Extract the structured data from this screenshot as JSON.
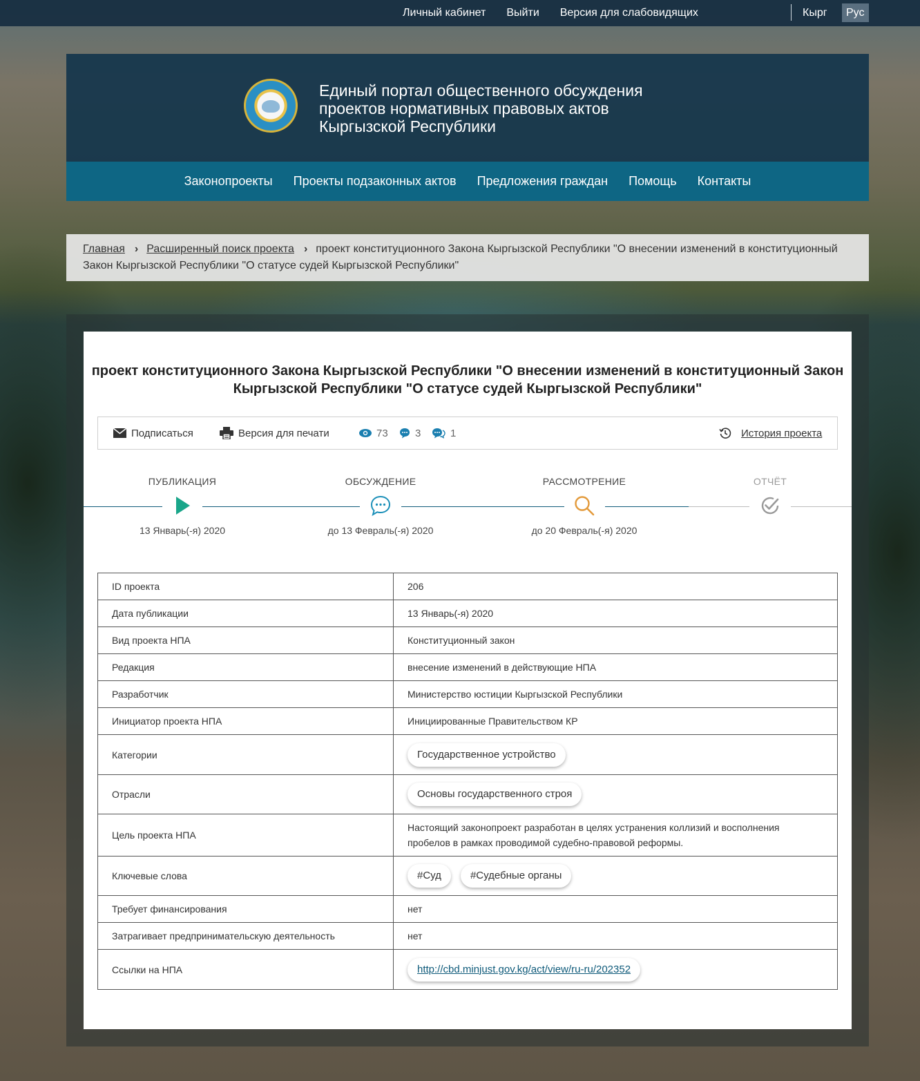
{
  "topbar": {
    "cabinet": "Личный кабинет",
    "logout": "Выйти",
    "low_vision": "Версия для слабовидящих",
    "lang_kg": "Кырг",
    "lang_ru": "Рус"
  },
  "header": {
    "title_lines": [
      "Единый портал общественного обсуждения",
      "проектов нормативных правовых актов",
      "Кыргызской Республики"
    ]
  },
  "nav": [
    "Законопроекты",
    "Проекты подзаконных актов",
    "Предложения граждан",
    "Помощь",
    "Контакты"
  ],
  "breadcrumb": {
    "home": "Главная",
    "search": "Расширенный поиск проекта",
    "current": "проект конституционного Закона Кыргызской Республики \"О внесении изменений в конституционный Закон Кыргызской Республики \"О статусе судей Кыргызской Республики\""
  },
  "project": {
    "title_lines": [
      "проект конституционного Закона Кыргызской Республики \"О внесении изменений в конституционный Закон",
      "Кыргызской Республики \"О статусе судей Кыргызской Республики\""
    ]
  },
  "toolbar": {
    "subscribe": "Подписаться",
    "print": "Версия для печати",
    "views": "73",
    "comments": "3",
    "proposals": "1",
    "history": "История проекта"
  },
  "timeline": [
    {
      "label": "ПУБЛИКАЦИЯ",
      "date": "13 Январь(-я) 2020",
      "icon": "play-icon"
    },
    {
      "label": "ОБСУЖДЕНИЕ",
      "date": "до 13 Февраль(-я) 2020",
      "icon": "chat-icon"
    },
    {
      "label": "РАССМОТРЕНИЕ",
      "date": "до 20 Февраль(-я) 2020",
      "icon": "search-icon"
    },
    {
      "label": "ОТЧЁТ",
      "date": "",
      "icon": "check-circle-icon"
    }
  ],
  "info": {
    "id_label": "ID проекта",
    "id_value": "206",
    "pub_label": "Дата публикации",
    "pub_value": "13 Январь(-я) 2020",
    "type_label": "Вид проекта НПА",
    "type_value": "Конституционный закон",
    "edition_label": "Редакция",
    "edition_value": "внесение изменений в действующие НПА",
    "dev_label": "Разработчик",
    "dev_value": "Министерство юстиции Кыргызской Республики",
    "init_label": "Инициатор проекта НПА",
    "init_value": "Инициированные Правительством КР",
    "cat_label": "Категории",
    "cat_value": "Государственное устройство",
    "branch_label": "Отрасли",
    "branch_value": "Основы государственного строя",
    "goal_label": "Цель проекта НПА",
    "goal_lines": [
      "Настоящий законопроект разработан в целях устранения коллизий и восполнения",
      "пробелов в рамках проводимой судебно-правовой реформы."
    ],
    "kw_label": "Ключевые слова",
    "kw_values": [
      "#Суд",
      "#Судебные органы"
    ],
    "fin_label": "Требует финансирования",
    "fin_value": "нет",
    "biz_label": "Затрагивает предпринимательскую деятельность",
    "biz_value": "нет",
    "links_label": "Ссылки на НПА",
    "links_value": "http://cbd.minjust.gov.kg/act/view/ru-ru/202352"
  },
  "colors": {
    "nav_bg": "#0e6684",
    "header_bg": "#12344b",
    "play": "#1aa68a",
    "chat": "#1a8fb8",
    "search": "#e39a3b",
    "done": "#999999"
  }
}
